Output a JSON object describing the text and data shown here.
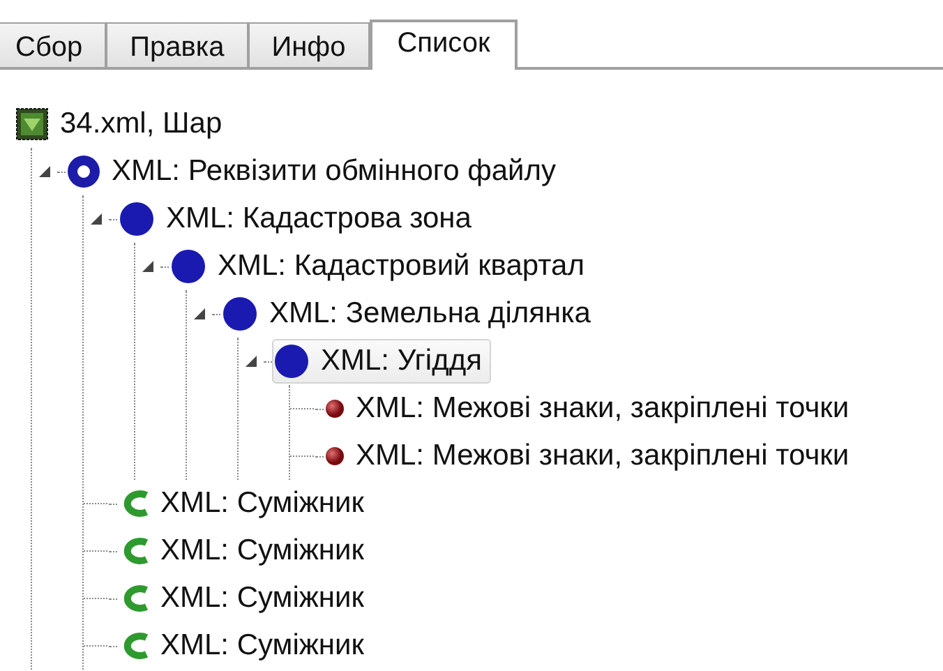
{
  "tabs": [
    {
      "label": "Сбор",
      "selected": false
    },
    {
      "label": "Правка",
      "selected": false
    },
    {
      "label": "Инфо",
      "selected": false
    },
    {
      "label": "Список",
      "selected": true
    }
  ],
  "tree": [
    {
      "label": "34.xml, Шар",
      "kind": "layer",
      "selected": false,
      "children": [
        {
          "label": "XML: Реквізити обмінного файлу",
          "kind": "ring",
          "expanded": true,
          "selected": false,
          "children": [
            {
              "label": "XML: Кадастрова зона",
              "kind": "disc",
              "expanded": true,
              "selected": false,
              "children": [
                {
                  "label": "XML: Кадастровий квартал",
                  "kind": "disc",
                  "expanded": true,
                  "selected": false,
                  "children": [
                    {
                      "label": "XML: Земельна ділянка",
                      "kind": "disc",
                      "expanded": true,
                      "selected": false,
                      "children": [
                        {
                          "label": "XML: Угіддя",
                          "kind": "disc",
                          "expanded": true,
                          "selected": true,
                          "children": [
                            {
                              "label": "XML: Межові знаки, закріплені точки",
                              "kind": "dot",
                              "expanded": false,
                              "selected": false
                            },
                            {
                              "label": "XML: Межові знаки, закріплені точки",
                              "kind": "dot",
                              "expanded": false,
                              "selected": false
                            }
                          ]
                        }
                      ]
                    }
                  ]
                }
              ]
            },
            {
              "label": "XML: Суміжник",
              "kind": "arc",
              "expanded": false,
              "selected": false
            },
            {
              "label": "XML: Суміжник",
              "kind": "arc",
              "expanded": false,
              "selected": false
            },
            {
              "label": "XML: Суміжник",
              "kind": "arc",
              "expanded": false,
              "selected": false
            },
            {
              "label": "XML: Суміжник",
              "kind": "arc",
              "expanded": false,
              "selected": false
            }
          ]
        }
      ]
    }
  ]
}
